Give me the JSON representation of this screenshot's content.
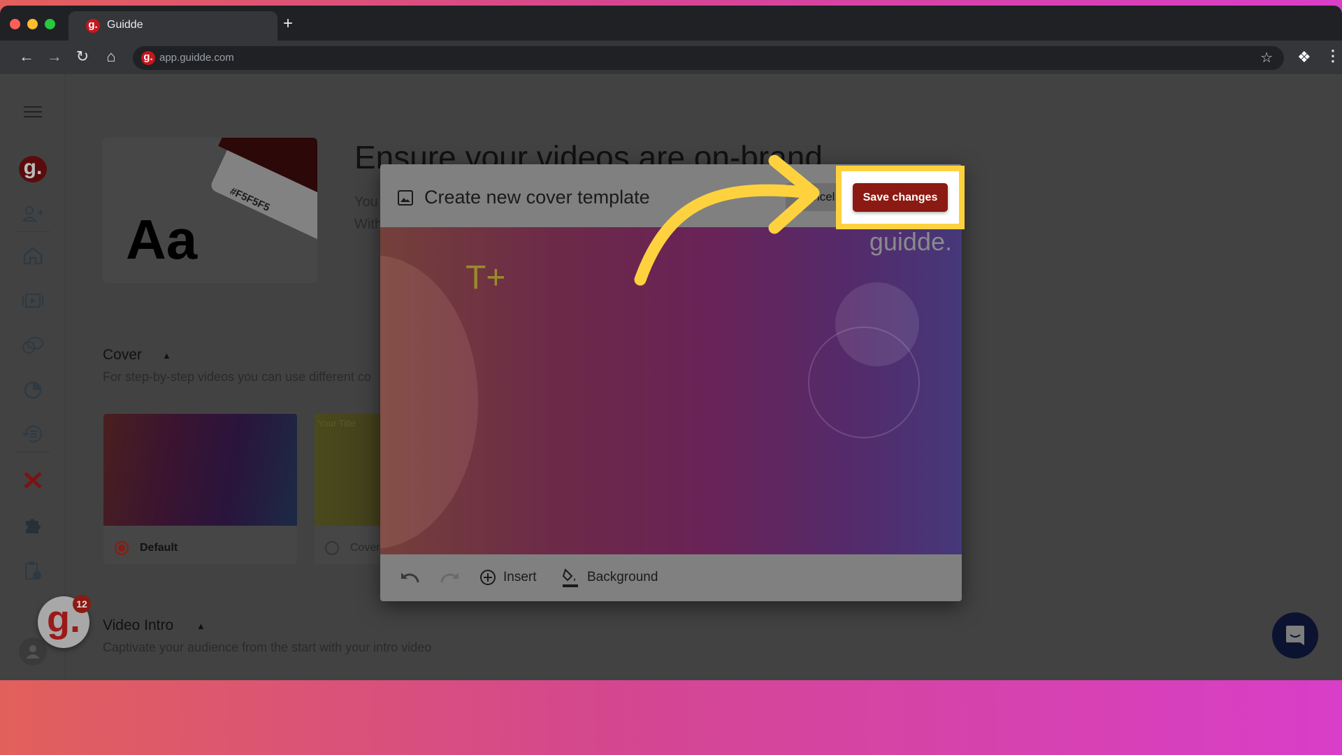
{
  "browser": {
    "tab_title": "Guidde",
    "url": "app.guidde.com",
    "favicon_letter": "g."
  },
  "page": {
    "heading": "Ensure your videos are on-brand",
    "intro_line1": "You",
    "intro_line2": "With",
    "brand_card": {
      "sample_text": "Aa",
      "color_hex": "#F5F5F5"
    },
    "cover": {
      "title": "Cover",
      "description": "For step-by-step videos you can use different co",
      "cards": [
        {
          "label": "Default",
          "selected": true
        },
        {
          "label": "Cover",
          "selected": false,
          "preview_text": "Your Title"
        }
      ]
    },
    "video_intro": {
      "title": "Video Intro",
      "description": "Captivate your audience from the start with your intro video"
    },
    "badge_count": "12",
    "logo_letter": "g."
  },
  "dialog": {
    "title": "Create new cover template",
    "cancel_label": "Cancel",
    "save_label": "Save changes",
    "canvas": {
      "watermark": "guidde.",
      "add_text": "T+"
    },
    "toolbar": {
      "insert_label": "Insert",
      "background_label": "Background"
    }
  },
  "colors": {
    "accent": "#8b1a12",
    "highlight": "#fdd23e",
    "brand_red": "#c4161c"
  },
  "sidebar": {
    "items": [
      "menu-icon",
      "workspace-logo",
      "invite-user-icon",
      "home-icon",
      "videos-icon",
      "spaces-icon",
      "analytics-icon",
      "history-icon",
      "brand-kit-icon",
      "integrations-icon",
      "clipboard-icon",
      "profile-icon"
    ]
  }
}
